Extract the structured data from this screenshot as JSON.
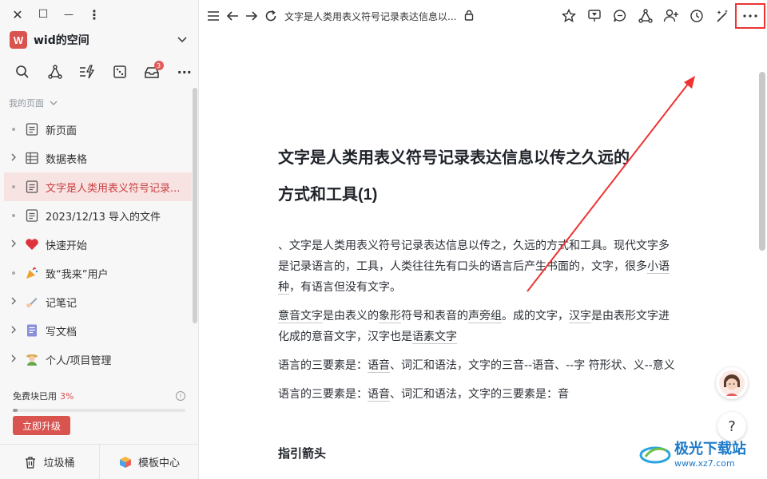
{
  "window": {
    "close": "✕",
    "maximize": "☐",
    "minimize": "—",
    "menu": "⋮"
  },
  "space": {
    "logo_letter": "W",
    "name": "wid的空间"
  },
  "toolbar_badge": "3",
  "section_title": "我的页面",
  "tree": [
    {
      "label": "新页面",
      "icon": "page-icon",
      "lead": "dot"
    },
    {
      "label": "数据表格",
      "icon": "table-icon",
      "lead": "chevron"
    },
    {
      "label": "文字是人类用表义符号记录...",
      "icon": "page-icon",
      "lead": "dot",
      "active": true
    },
    {
      "label": "2023/12/13 导入的文件",
      "icon": "page-icon",
      "lead": "dot"
    },
    {
      "label": "快速开始",
      "icon": "heart-icon",
      "lead": "chevron"
    },
    {
      "label": "致“我来”用户",
      "icon": "party-popper-icon",
      "lead": "dot"
    },
    {
      "label": "记笔记",
      "icon": "writing-hand-icon",
      "lead": "chevron"
    },
    {
      "label": "写文档",
      "icon": "document-icon",
      "lead": "chevron"
    },
    {
      "label": "个人/项目管理",
      "icon": "farmer-icon",
      "lead": "chevron"
    }
  ],
  "quota": {
    "label": "免费块已用",
    "percent": "3%",
    "fraction": 0.03
  },
  "upgrade_label": "立即升级",
  "bottom": {
    "trash": "垃圾桶",
    "templates": "模板中心"
  },
  "topbar": {
    "title": "文字是人类用表义符号记录表达信息以..."
  },
  "doc": {
    "title_line1": "文字是人类用表义符号记录表达信息以传之久远的",
    "title_line2": "方式和工具(1)",
    "p1": "、文字是人类用表义符号记录表达信息以传之，久远的方式和工具。现代文字多是记录语言的，工具，人类往往先有口头的语言后产生书面的，文字，很多",
    "p1_link": "小语种",
    "p1_tail": "，有语言但没有文字。",
    "p2_a": "意音文字",
    "p2_b": "是由表义的",
    "p2_c": "象形",
    "p2_d": "符号和表音的",
    "p2_e": "声旁组",
    "p2_f": "。成的文字，",
    "p2_g": "汉字",
    "p2_h": "是由表形文字进化成的意音文字，汉字也是",
    "p2_i": "语素文字",
    "p3_a": "语言的三要素是：",
    "p3_b": "语音",
    "p3_c": "、词汇和语法，文字的三音--语音、--字 符形状、义--意义",
    "p4_a": "语言的三要素是：",
    "p4_b": "语音",
    "p4_c": "、词汇和语法，文字的三要素是：音",
    "heading": "指引箭头"
  },
  "help_label": "?",
  "watermark": {
    "main": "极光下载站",
    "sub": "www.xz7.com"
  },
  "colors": {
    "accent": "#d9534f",
    "active_bg": "#f8e3e3",
    "highlight_box": "#ee3333"
  }
}
